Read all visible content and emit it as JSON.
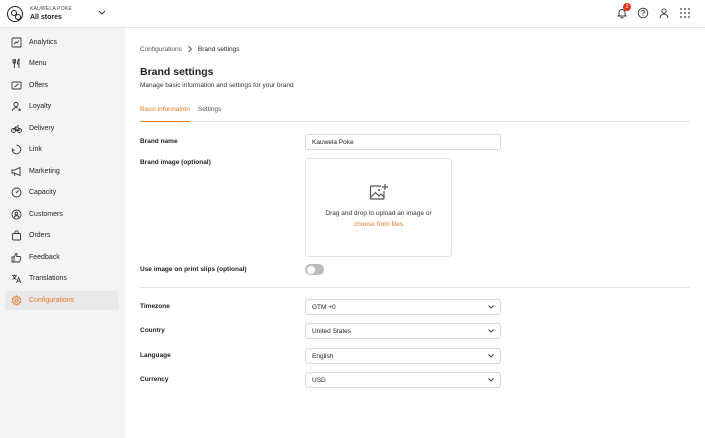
{
  "store": {
    "brand": "KAUWELA POKE",
    "name": "All stores"
  },
  "topbar": {
    "notification_count": "3"
  },
  "sidebar": {
    "items": [
      {
        "label": "Analytics",
        "icon": "analytics-icon"
      },
      {
        "label": "Menu",
        "icon": "cutlery-icon"
      },
      {
        "label": "Offers",
        "icon": "ticket-icon"
      },
      {
        "label": "Loyalty",
        "icon": "user-star-icon"
      },
      {
        "label": "Delivery",
        "icon": "bike-icon"
      },
      {
        "label": "Link",
        "icon": "link-icon"
      },
      {
        "label": "Marketing",
        "icon": "megaphone-icon"
      },
      {
        "label": "Capacity",
        "icon": "gauge-icon"
      },
      {
        "label": "Customers",
        "icon": "customers-icon"
      },
      {
        "label": "Orders",
        "icon": "bag-icon"
      },
      {
        "label": "Feedback",
        "icon": "thumbs-up-icon"
      },
      {
        "label": "Translations",
        "icon": "translate-icon"
      },
      {
        "label": "Configurations",
        "icon": "gear-icon",
        "active": true
      }
    ],
    "active_color": "#e87722"
  },
  "breadcrumb": {
    "parent": "Configurations",
    "current": "Brand settings"
  },
  "page": {
    "title": "Brand settings",
    "subtitle": "Manage basic information and settings for your brand"
  },
  "tabs": [
    {
      "label": "Basic information",
      "active": true
    },
    {
      "label": "Settings",
      "active": false
    }
  ],
  "form": {
    "brand_name_label": "Brand name",
    "brand_name_value": "Kauwela Poke",
    "brand_image_label": "Brand image (optional)",
    "dropzone_text": "Drag and drop to upload an image or",
    "dropzone_link": "choose from files",
    "print_slips_label": "Use image on print slips (optional)",
    "print_slips_enabled": false,
    "timezone_label": "Timezone",
    "timezone_value": "GTM +0",
    "country_label": "Country",
    "country_value": "United States",
    "language_label": "Language",
    "language_value": "English",
    "currency_label": "Currency",
    "currency_value": "USD"
  }
}
